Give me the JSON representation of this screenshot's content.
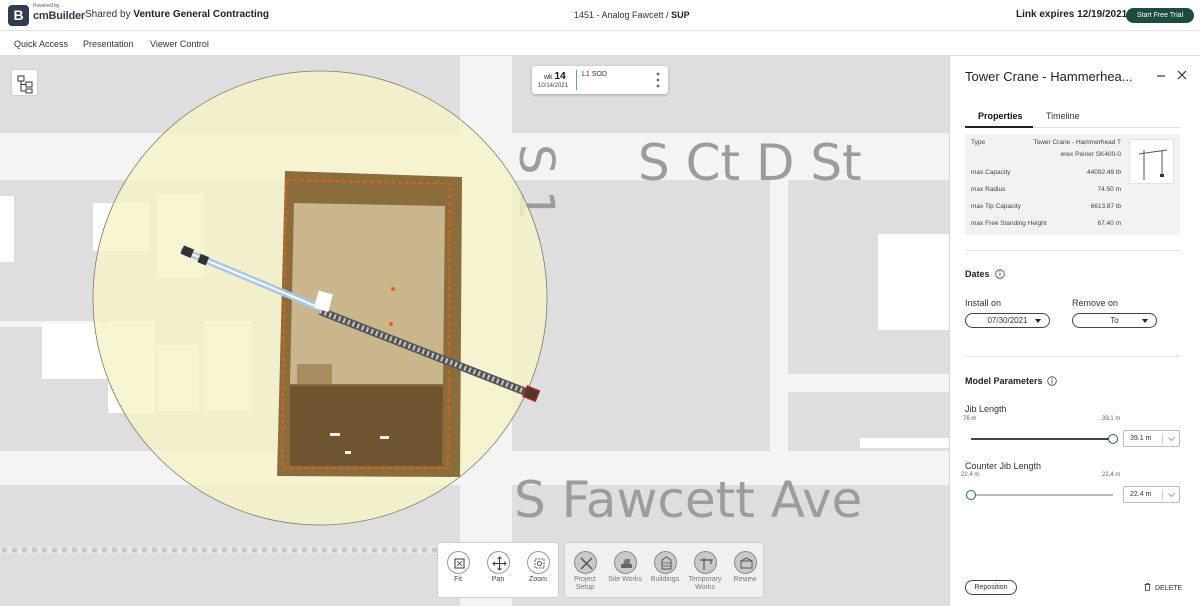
{
  "header": {
    "logo_powered": "Powered by",
    "logo_letter": "B",
    "logo_brand": "cmBuilder",
    "shared_prefix": "Shared by",
    "shared_company": "Venture General Contracting",
    "project_prefix": "1451 - Analog Fawcett /",
    "project_suffix": "SUP",
    "link_expires": "Link expires 12/19/2021",
    "trial_button": "Start Free Trial"
  },
  "menu": {
    "items": [
      "Quick Access",
      "Presentation",
      "Viewer Control"
    ]
  },
  "map": {
    "street_labels": [
      "S Ct D St",
      "S Fawcett Ave",
      "S 1"
    ],
    "week_label": "wk",
    "week_number": "14",
    "week_date": "10/14/2021",
    "phase": "L1 SOD",
    "colors": {
      "background": "#dedede",
      "road": "#f4f4f4",
      "building": "#ffffff",
      "crane_radius_fill": "#f6f4c8",
      "site_brown": "#8a6d3b",
      "site_dark": "#6e5530",
      "site_inner": "#c9b68c",
      "boundary_orange": "#e8601c",
      "jib": "#6a6a6a",
      "counter_jib": "#a9c7e6"
    }
  },
  "toolbar": {
    "nav": [
      {
        "label": "Fit",
        "icon": "fit-icon"
      },
      {
        "label": "Pan",
        "icon": "pan-icon"
      },
      {
        "label": "Zoom",
        "icon": "zoom-icon"
      }
    ],
    "tools": [
      {
        "label": "Project Setup",
        "icon": "tools-icon"
      },
      {
        "label": "Site Works",
        "icon": "excavator-icon"
      },
      {
        "label": "Buildings",
        "icon": "building-icon"
      },
      {
        "label": "Temporary Works",
        "icon": "crane-icon"
      },
      {
        "label": "Review",
        "icon": "review-icon"
      }
    ]
  },
  "panel": {
    "title": "Tower Crane - Hammerhea...",
    "tabs": {
      "properties": "Properties",
      "timeline": "Timeline"
    },
    "properties": [
      {
        "key": "Type",
        "value": "Tower Crane - Hammerhead T",
        "value2": "erex Peiner SK400-0"
      },
      {
        "key": "max Capacity",
        "value": "44092.49 lb"
      },
      {
        "key": "max Radius",
        "value": "74.50 m"
      },
      {
        "key": "max Tip Capacity",
        "value": "6613.87 lb"
      },
      {
        "key": "max Free Standing Height",
        "value": "67.40 m"
      }
    ],
    "dates": {
      "heading": "Dates",
      "install_label": "Install on",
      "install_value": "07/30/2021",
      "remove_label": "Remove on",
      "remove_value": "To"
    },
    "model": {
      "heading": "Model Parameters",
      "jib_label": "Jib Length",
      "jib_min": "76 m",
      "jib_max": "39.1 m",
      "jib_value": "39.1 m",
      "counter_label": "Counter Jib Length",
      "counter_min": "22.4 m",
      "counter_max": "22.4 m",
      "counter_value": "22.4 m"
    },
    "reposition": "Reposition",
    "delete": "DELETE"
  }
}
